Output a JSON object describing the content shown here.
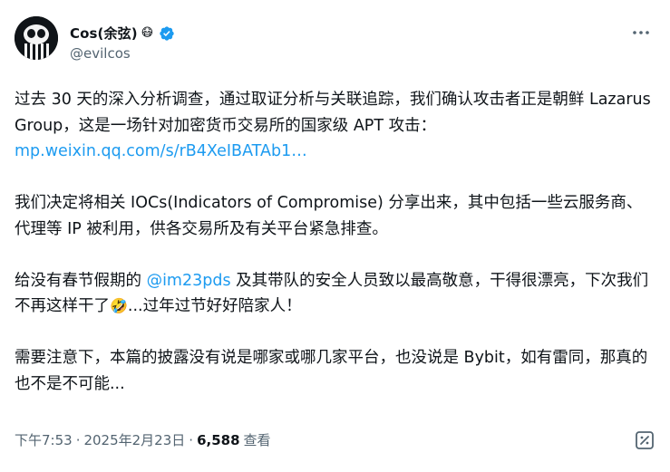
{
  "author": {
    "display_name": "Cos(余弦)",
    "badge_emoji": "😷",
    "handle": "@evilcos"
  },
  "tweet": {
    "para1_text": "过去 30 天的深入分析调查，通过取证分析与关联追踪，我们确认攻击者正是朝鲜 Lazarus Group，这是一场针对加密货币交易所的国家级 APT 攻击：",
    "para1_link": "mp.weixin.qq.com/s/rB4XeIBATAb1…",
    "para2_text": "我们决定将相关 IOCs(Indicators of Compromise) 分享出来，其中包括一些云服务商、代理等 IP 被利用，供各交易所及有关平台紧急排查。",
    "para3_before": "给没有春节假期的 ",
    "para3_mention": "@im23pds",
    "para3_after": " 及其带队的安全人员致以最高敬意，干得很漂亮，下次我们不再这样干了",
    "para3_emoji": "🤣",
    "para3_tail": "...过年过节好好陪家人！",
    "para4_text": "需要注意下，本篇的披露没有说是哪家或哪几家平台，也没说是 Bybit，如有雷同，那真的也不是不可能..."
  },
  "meta": {
    "time": "下午7:53",
    "separator1": "·",
    "date": "2025年2月23日",
    "separator2": "·",
    "views_count": "6,588",
    "views_label": "查看"
  },
  "colors": {
    "link": "#1d9bf0",
    "secondary_text": "#536471",
    "primary_text": "#0f1419",
    "verified": "#1d9bf0"
  },
  "icons": {
    "verified": "verified-badge-icon",
    "more": "more-horizontal-icon",
    "grok": "grok-icon"
  }
}
